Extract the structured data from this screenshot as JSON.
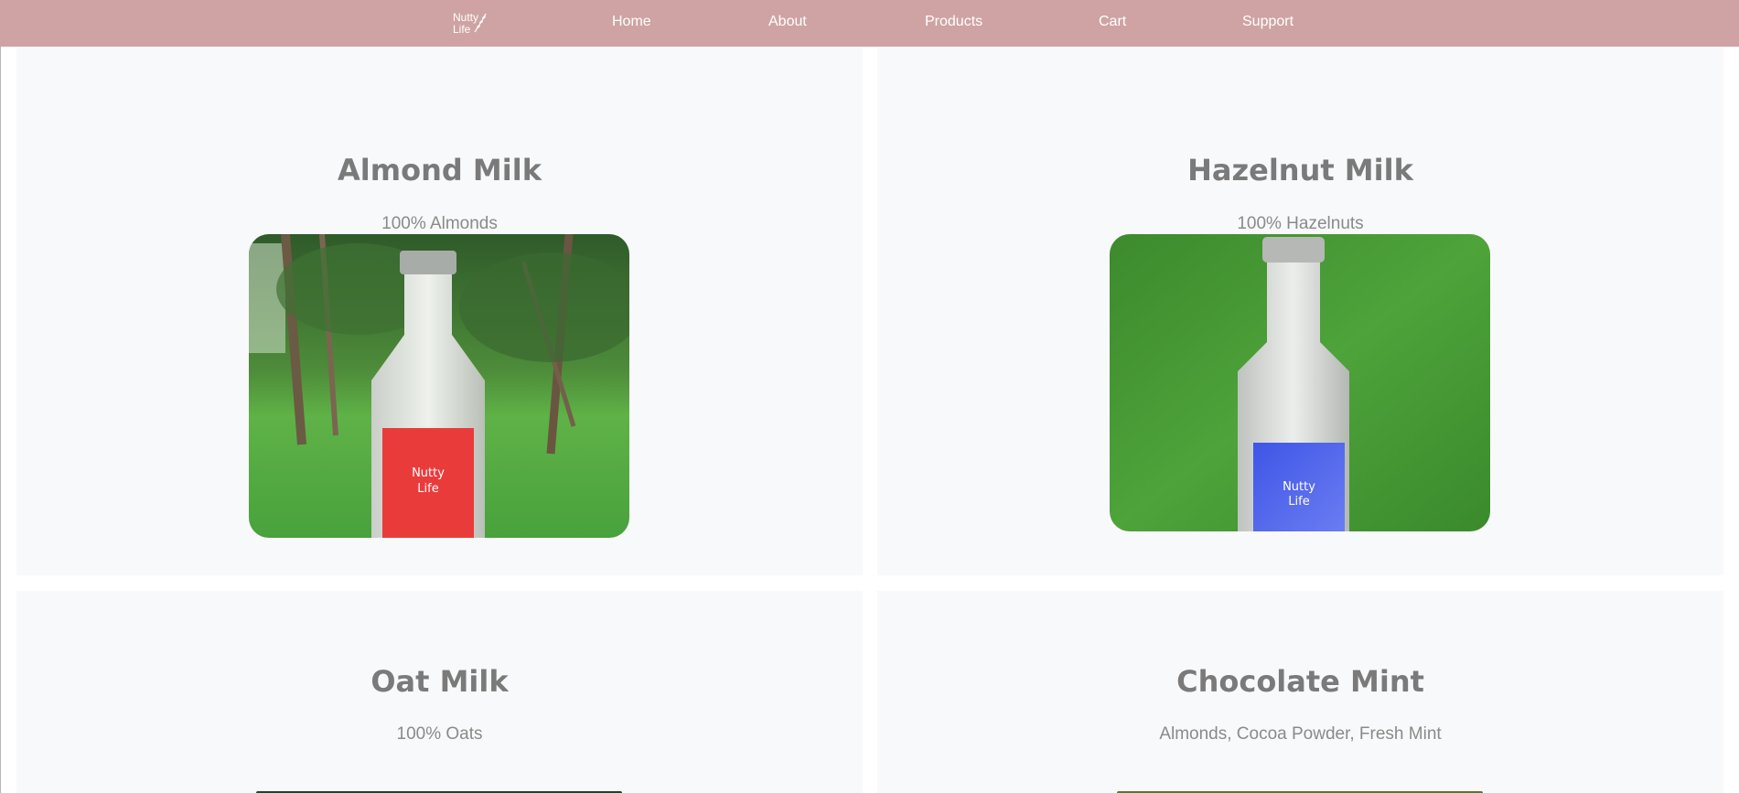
{
  "nav": {
    "logo": {
      "line1": "Nutty",
      "line2": "Life"
    },
    "links": [
      "Home",
      "About",
      "Products",
      "Cart",
      "Support"
    ]
  },
  "products": [
    {
      "name": "Almond Milk",
      "ingredients": "100% Almonds",
      "label_color": "#ea3b3b",
      "bottle_label_text": "Nutty Life"
    },
    {
      "name": "Hazelnut Milk",
      "ingredients": "100% Hazelnuts",
      "label_color": "#4f6cf0",
      "bottle_label_text": "Nutty Life"
    },
    {
      "name": "Oat Milk",
      "ingredients": "100% Oats"
    },
    {
      "name": "Chocolate Mint",
      "ingredients": "Almonds, Cocoa Powder, Fresh Mint"
    }
  ],
  "colors": {
    "navbar": "#cfa3a3",
    "card_bg": "#f8f9fa",
    "title_text": "#7a7a7a"
  }
}
